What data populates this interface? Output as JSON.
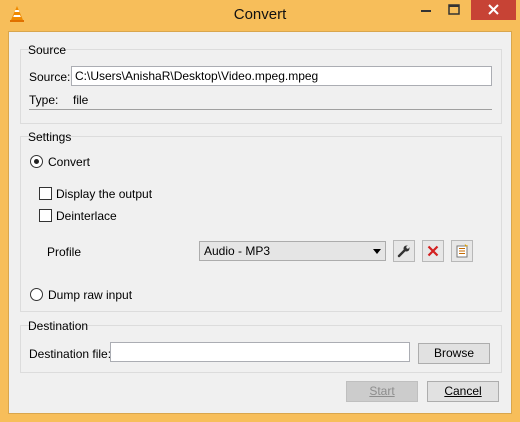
{
  "window": {
    "title": "Convert"
  },
  "source": {
    "group_title": "Source",
    "source_label": "Source:",
    "source_value": "C:\\Users\\AnishaR\\Desktop\\Video.mpeg.mpeg",
    "type_label": "Type:",
    "type_value": "file"
  },
  "settings": {
    "group_title": "Settings",
    "convert_label": "Convert",
    "convert_selected": true,
    "display_output_label": "Display the output",
    "display_output_checked": false,
    "deinterlace_label": "Deinterlace",
    "deinterlace_checked": false,
    "profile_label": "Profile",
    "profile_value": "Audio - MP3",
    "dump_raw_label": "Dump raw input",
    "dump_raw_selected": false
  },
  "destination": {
    "group_title": "Destination",
    "file_label": "Destination file:",
    "file_value": "",
    "browse_label": "Browse"
  },
  "buttons": {
    "start_label": "Start",
    "start_enabled": false,
    "cancel_label": "Cancel"
  },
  "icons": {
    "app": "vlc-cone-icon",
    "minimize": "minimize-icon",
    "maximize": "maximize-icon",
    "close": "close-icon",
    "edit_profile": "wrench-icon",
    "delete_profile": "red-x-icon",
    "new_profile": "new-profile-icon"
  },
  "colors": {
    "titlebar": "#f7be5a",
    "close_button": "#c74335",
    "client_bg": "#f0f0f0",
    "delete_red": "#d32020",
    "primary_border": "#0078d7"
  }
}
